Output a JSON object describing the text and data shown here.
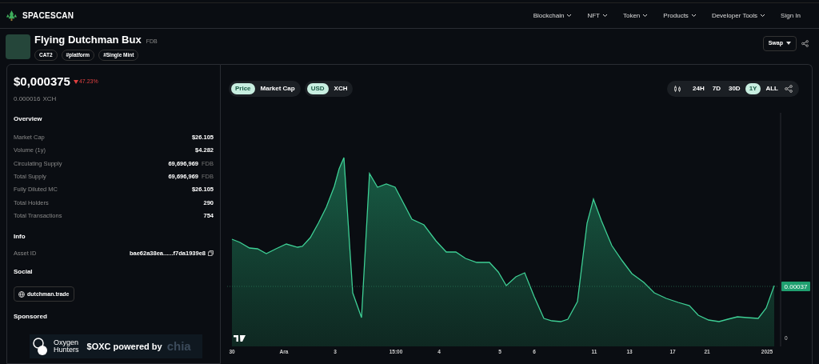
{
  "brand": "SPACESCAN",
  "nav": [
    {
      "label": "Blockchain",
      "dropdown": true
    },
    {
      "label": "NFT",
      "dropdown": true
    },
    {
      "label": "Token",
      "dropdown": true
    },
    {
      "label": "Products",
      "dropdown": true
    },
    {
      "label": "Developer Tools",
      "dropdown": true
    },
    {
      "label": "Sign In",
      "dropdown": false
    }
  ],
  "token": {
    "name": "Flying Dutchman Bux",
    "symbol": "FDB",
    "tags": [
      "CAT2",
      "#platform",
      "#Single Mint"
    ]
  },
  "swap_button": "Swap",
  "price": {
    "value": "$0,000375",
    "change": "47.23%",
    "falling": true,
    "xch": "0.000016",
    "xch_unit": "XCH"
  },
  "overview": {
    "title": "Overview",
    "rows": [
      {
        "label": "Market Cap",
        "value": "$26.105"
      },
      {
        "label": "Volume (1y)",
        "value": "$4.282"
      },
      {
        "label": "Circulating Supply",
        "value": "69,696,969",
        "unit": "FDB"
      },
      {
        "label": "Total Supply",
        "value": "69,696,969",
        "unit": "FDB"
      },
      {
        "label": "Fully Diluted MC",
        "value": "$26.105"
      },
      {
        "label": "Total Holders",
        "value": "290"
      },
      {
        "label": "Total Transactions",
        "value": "754"
      }
    ]
  },
  "info": {
    "title": "Info",
    "rows": [
      {
        "label": "Asset ID",
        "value": "bae62a38ea......f7da1939e8"
      }
    ]
  },
  "social": {
    "title": "Social",
    "links": [
      "dutchman.trade"
    ]
  },
  "sponsored": {
    "title": "Sponsored",
    "banner": {
      "brand_line_1": "Oxygen",
      "brand_line_2": "Hunters",
      "text": "$OXC powered by",
      "partner": "chia"
    }
  },
  "chart": {
    "metric_toggle": [
      {
        "label": "Price",
        "selected": true
      },
      {
        "label": "Market Cap",
        "selected": false
      }
    ],
    "currency_toggle": [
      {
        "label": "USD",
        "selected": true
      },
      {
        "label": "XCH",
        "selected": false
      }
    ],
    "ranges": [
      {
        "label": "24H",
        "selected": false
      },
      {
        "label": "7D",
        "selected": false
      },
      {
        "label": "30D",
        "selected": false
      },
      {
        "label": "1Y",
        "selected": true
      },
      {
        "label": "ALL",
        "selected": false
      }
    ],
    "x_labels": [
      "30",
      "Ara",
      "3",
      "15:00",
      "4",
      "5",
      "6",
      "11",
      "13",
      "17",
      "21",
      "2025"
    ],
    "y_label": "0",
    "last_price": "0.00037"
  }
}
